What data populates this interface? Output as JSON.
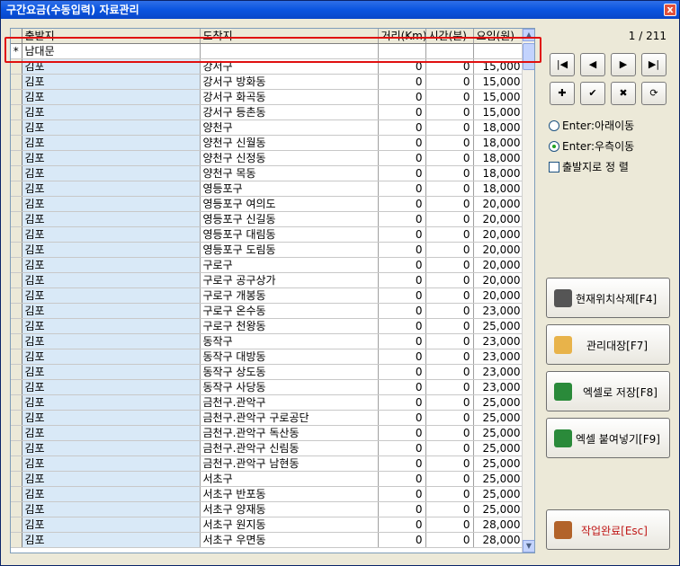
{
  "window": {
    "title": "구간요금(수동입력) 자료관리",
    "close": "x"
  },
  "grid": {
    "columns": [
      "출발지",
      "도착지",
      "거리(Km)",
      "시간(분)",
      "요임(원)"
    ],
    "new_row_marker": "*",
    "new_row_value": "남대문",
    "rows": [
      [
        "김포",
        "강서구",
        "0",
        "0",
        "15,000"
      ],
      [
        "김포",
        "강서구 방화동",
        "0",
        "0",
        "15,000"
      ],
      [
        "김포",
        "강서구 화곡동",
        "0",
        "0",
        "15,000"
      ],
      [
        "김포",
        "강서구 등촌동",
        "0",
        "0",
        "15,000"
      ],
      [
        "김포",
        "양천구",
        "0",
        "0",
        "18,000"
      ],
      [
        "김포",
        "양천구 신월동",
        "0",
        "0",
        "18,000"
      ],
      [
        "김포",
        "양천구 신정동",
        "0",
        "0",
        "18,000"
      ],
      [
        "김포",
        "양천구 목동",
        "0",
        "0",
        "18,000"
      ],
      [
        "김포",
        "영등포구",
        "0",
        "0",
        "18,000"
      ],
      [
        "김포",
        "영등포구 여의도",
        "0",
        "0",
        "20,000"
      ],
      [
        "김포",
        "영등포구 신길동",
        "0",
        "0",
        "20,000"
      ],
      [
        "김포",
        "영등포구 대림동",
        "0",
        "0",
        "20,000"
      ],
      [
        "김포",
        "영등포구 도림동",
        "0",
        "0",
        "20,000"
      ],
      [
        "김포",
        "구로구",
        "0",
        "0",
        "20,000"
      ],
      [
        "김포",
        "구로구 공구상가",
        "0",
        "0",
        "20,000"
      ],
      [
        "김포",
        "구로구 개봉동",
        "0",
        "0",
        "20,000"
      ],
      [
        "김포",
        "구로구 온수동",
        "0",
        "0",
        "23,000"
      ],
      [
        "김포",
        "구로구 천왕동",
        "0",
        "0",
        "25,000"
      ],
      [
        "김포",
        "동작구",
        "0",
        "0",
        "23,000"
      ],
      [
        "김포",
        "동작구 대방동",
        "0",
        "0",
        "23,000"
      ],
      [
        "김포",
        "동작구 상도동",
        "0",
        "0",
        "23,000"
      ],
      [
        "김포",
        "동작구 사당동",
        "0",
        "0",
        "23,000"
      ],
      [
        "김포",
        "금천구.관악구",
        "0",
        "0",
        "25,000"
      ],
      [
        "김포",
        "금천구.관악구 구로공단",
        "0",
        "0",
        "25,000"
      ],
      [
        "김포",
        "금천구.관악구 독산동",
        "0",
        "0",
        "25,000"
      ],
      [
        "김포",
        "금천구.관악구 신림동",
        "0",
        "0",
        "25,000"
      ],
      [
        "김포",
        "금천구.관악구 남현동",
        "0",
        "0",
        "25,000"
      ],
      [
        "김포",
        "서초구",
        "0",
        "0",
        "25,000"
      ],
      [
        "김포",
        "서초구 반포동",
        "0",
        "0",
        "25,000"
      ],
      [
        "김포",
        "서초구 양재동",
        "0",
        "0",
        "25,000"
      ],
      [
        "김포",
        "서초구 원지동",
        "0",
        "0",
        "28,000"
      ],
      [
        "김포",
        "서초구 우면동",
        "0",
        "0",
        "28,000"
      ]
    ]
  },
  "pager": {
    "text": "1 / 211"
  },
  "nav": {
    "first": "|◀",
    "prev": "◀",
    "next": "▶",
    "last": "▶|",
    "add": "✚",
    "confirm": "✔",
    "cancel": "✖",
    "refresh": "⟳"
  },
  "options": {
    "enter_down": "Enter:아래이동",
    "enter_right": "Enter:우측이동",
    "sort_by_origin": "출발지로 정 렬",
    "selected": "enter_right"
  },
  "actions": {
    "delete": "현재위치삭제[F4]",
    "ledger": "관리대장[F7]",
    "excel_save": "엑셀로 저장[F8]",
    "excel_paste": "엑셀 붙여넣기[F9]",
    "done": "작업완료[Esc]"
  },
  "colors": {
    "accent": "#0a54e0",
    "from_col": "#d9e9f7",
    "highlight": "#e01010"
  }
}
